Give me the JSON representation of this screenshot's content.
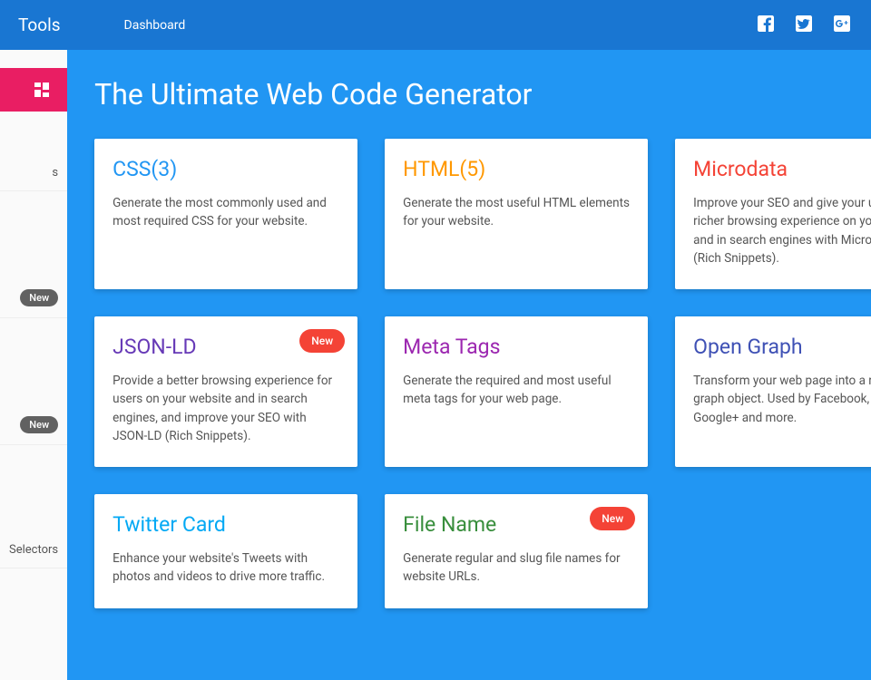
{
  "topbar": {
    "brand": "Tools",
    "nav": "Dashboard"
  },
  "sidebar": {
    "item_s": "s",
    "new_badge": "New",
    "selectors": "Selectors"
  },
  "page": {
    "title": "The Ultimate Web Code Generator"
  },
  "cards": {
    "css": {
      "title": "CSS(3)",
      "desc": "Generate the most commonly used and most required CSS for your website."
    },
    "html": {
      "title": "HTML(5)",
      "desc": "Generate the most useful HTML elements for your website."
    },
    "microdata": {
      "title": "Microdata",
      "desc": "Improve your SEO and give your users a richer browsing experience on your site and in search engines with Microdata (Rich Snippets)."
    },
    "jsonld": {
      "title": "JSON-LD",
      "desc": "Provide a better browsing experience for users on your website and in search engines, and improve your SEO with JSON-LD (Rich Snippets).",
      "badge": "New"
    },
    "meta": {
      "title": "Meta Tags",
      "desc": "Generate the required and most useful meta tags for your web page."
    },
    "og": {
      "title": "Open Graph",
      "desc": "Transform your web page into a rich graph object. Used by Facebook, Twitter, Google+ and more."
    },
    "twitter": {
      "title": "Twitter Card",
      "desc": "Enhance your website's Tweets with photos and videos to drive more traffic."
    },
    "filename": {
      "title": "File Name",
      "desc": "Generate regular and slug file names for website URLs.",
      "badge": "New"
    }
  }
}
